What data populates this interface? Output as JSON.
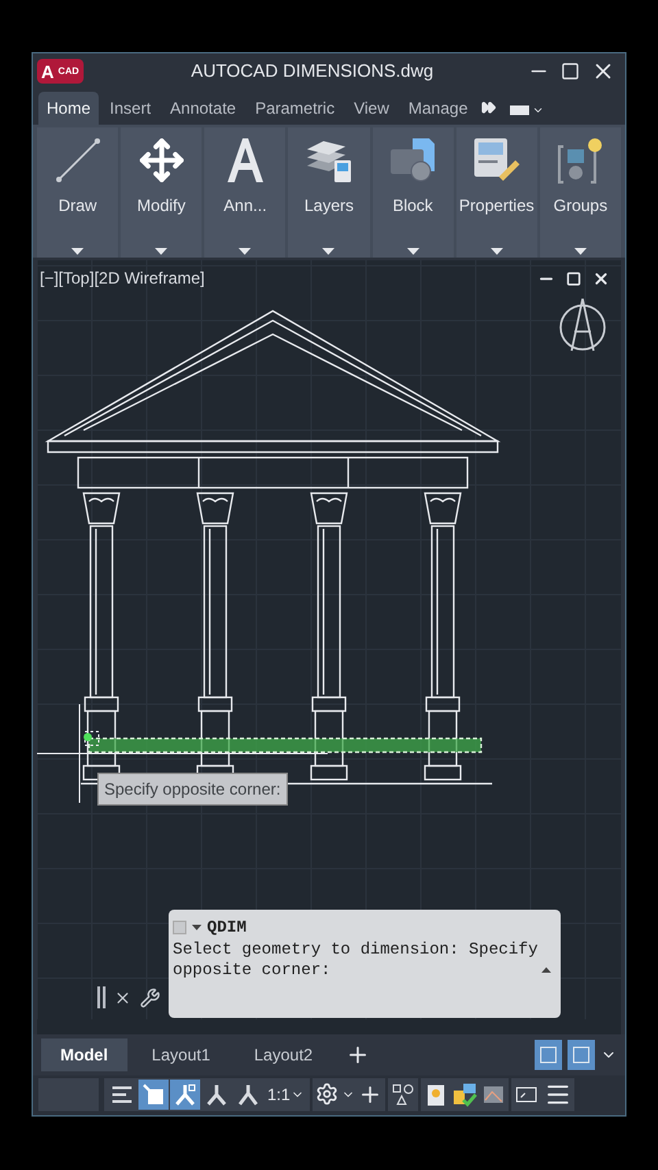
{
  "window": {
    "title": "AUTOCAD DIMENSIONS.dwg",
    "logo_letter": "A",
    "logo_text": "CAD"
  },
  "ribbon_tabs": [
    {
      "label": "Home",
      "selected": true
    },
    {
      "label": "Insert",
      "selected": false
    },
    {
      "label": "Annotate",
      "selected": false
    },
    {
      "label": "Parametric",
      "selected": false
    },
    {
      "label": "View",
      "selected": false
    },
    {
      "label": "Manage",
      "selected": false
    }
  ],
  "ribbon_panels": [
    {
      "label": "Draw",
      "kind": "draw"
    },
    {
      "label": "Modify",
      "kind": "modify"
    },
    {
      "label": "Ann...",
      "kind": "annotate"
    },
    {
      "label": "Layers",
      "kind": "layers"
    },
    {
      "label": "Block",
      "kind": "block"
    },
    {
      "label": "Properties",
      "kind": "properties"
    },
    {
      "label": "Groups",
      "kind": "groups"
    }
  ],
  "viewport": {
    "label": "[−][Top][2D Wireframe]",
    "tooltip": "Specify opposite corner:"
  },
  "command": {
    "name": "QDIM",
    "history": "Select geometry to dimension: Specify opposite corner:"
  },
  "layout_tabs": [
    {
      "label": "Model",
      "selected": true
    },
    {
      "label": "Layout1",
      "selected": false
    },
    {
      "label": "Layout2",
      "selected": false
    }
  ],
  "layout_toggles": [
    {
      "on": true
    },
    {
      "on": true
    }
  ],
  "status_bar": {
    "scale": "1:1",
    "toggles": [
      {
        "on": false
      },
      {
        "on": true
      },
      {
        "on": true
      },
      {
        "on": false
      },
      {
        "on": false
      }
    ]
  }
}
